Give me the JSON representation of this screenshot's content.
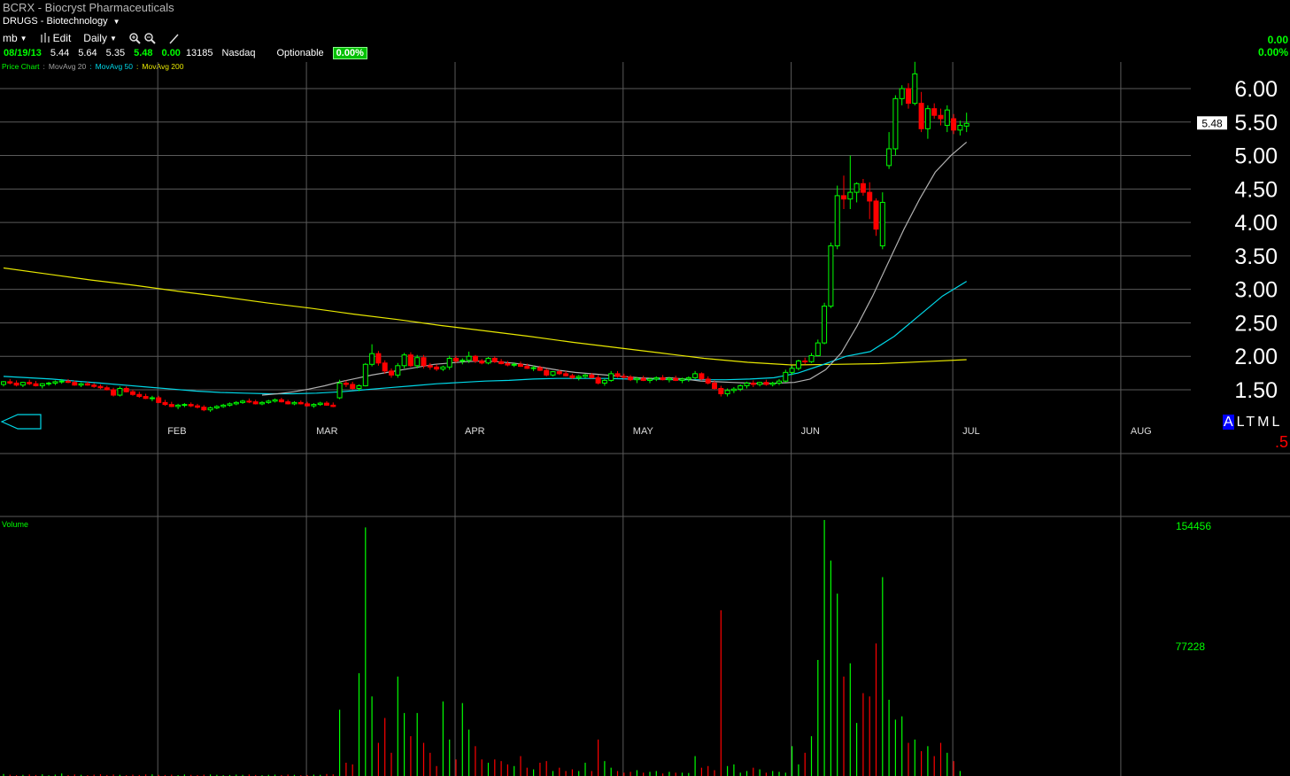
{
  "header": {
    "title": "BCRX - Biocryst Pharmaceuticals",
    "sector": "DRUGS - Biotechnology",
    "user_menu": "mb",
    "edit_label": "Edit",
    "period_label": "Daily"
  },
  "quote": {
    "date": "08/19/13",
    "open": "5.44",
    "high": "5.64",
    "low": "5.35",
    "close": "5.48",
    "change": "0.00",
    "volume": "13185",
    "exchange": "Nasdaq",
    "optionable_label": "Optionable",
    "pct_change": "0.00%"
  },
  "right_panel": {
    "change": "0.00",
    "pct_change": "0.00%"
  },
  "legend": {
    "price_chart": "Price Chart",
    "ma20": "MovAvg 20",
    "ma50": "MovAvg 50",
    "ma200": "MovAvg 200"
  },
  "colors": {
    "up": "#00ff00",
    "down": "#ff0000",
    "ma20": "#b0b0b0",
    "ma50": "#00d8e8",
    "ma200": "#e8e800",
    "grid": "#5a5a5a",
    "volume_label": "#00ff00"
  },
  "mode_buttons": [
    "A",
    "L",
    "T",
    "M",
    "L"
  ],
  "corner_value": ".5",
  "chart_data": {
    "type": "candlestick",
    "title": "BCRX - Biocryst Pharmaceuticals",
    "period": "Daily",
    "months": [
      "FEB",
      "MAR",
      "APR",
      "MAY",
      "JUN",
      "JUL",
      "AUG"
    ],
    "month_first_index": [
      24,
      47,
      70,
      96,
      122,
      147,
      173
    ],
    "ylim": [
      1.0,
      6.6
    ],
    "yticks": [
      6.0,
      5.5,
      5.0,
      4.5,
      4.0,
      3.5,
      3.0,
      2.5,
      2.0,
      1.5
    ],
    "last_price_label": "5.48",
    "candles": [
      [
        1.58,
        1.63,
        1.55,
        1.62
      ],
      [
        1.62,
        1.66,
        1.58,
        1.6
      ],
      [
        1.6,
        1.64,
        1.55,
        1.57
      ],
      [
        1.57,
        1.62,
        1.54,
        1.61
      ],
      [
        1.61,
        1.65,
        1.57,
        1.59
      ],
      [
        1.59,
        1.63,
        1.55,
        1.56
      ],
      [
        1.56,
        1.6,
        1.52,
        1.59
      ],
      [
        1.59,
        1.62,
        1.56,
        1.6
      ],
      [
        1.6,
        1.64,
        1.57,
        1.62
      ],
      [
        1.62,
        1.66,
        1.59,
        1.63
      ],
      [
        1.63,
        1.66,
        1.6,
        1.61
      ],
      [
        1.61,
        1.64,
        1.56,
        1.57
      ],
      [
        1.57,
        1.61,
        1.54,
        1.59
      ],
      [
        1.59,
        1.62,
        1.56,
        1.57
      ],
      [
        1.57,
        1.6,
        1.53,
        1.55
      ],
      [
        1.55,
        1.58,
        1.51,
        1.53
      ],
      [
        1.53,
        1.56,
        1.49,
        1.5
      ],
      [
        1.5,
        1.53,
        1.4,
        1.42
      ],
      [
        1.42,
        1.55,
        1.4,
        1.52
      ],
      [
        1.52,
        1.55,
        1.46,
        1.47
      ],
      [
        1.47,
        1.5,
        1.41,
        1.43
      ],
      [
        1.43,
        1.47,
        1.38,
        1.4
      ],
      [
        1.4,
        1.44,
        1.36,
        1.37
      ],
      [
        1.37,
        1.41,
        1.33,
        1.38
      ],
      [
        1.38,
        1.41,
        1.3,
        1.31
      ],
      [
        1.31,
        1.35,
        1.26,
        1.28
      ],
      [
        1.28,
        1.32,
        1.24,
        1.25
      ],
      [
        1.25,
        1.29,
        1.21,
        1.27
      ],
      [
        1.27,
        1.3,
        1.24,
        1.28
      ],
      [
        1.28,
        1.31,
        1.24,
        1.26
      ],
      [
        1.26,
        1.29,
        1.22,
        1.24
      ],
      [
        1.24,
        1.27,
        1.18,
        1.2
      ],
      [
        1.2,
        1.25,
        1.17,
        1.23
      ],
      [
        1.23,
        1.27,
        1.21,
        1.25
      ],
      [
        1.25,
        1.29,
        1.23,
        1.27
      ],
      [
        1.27,
        1.31,
        1.25,
        1.29
      ],
      [
        1.29,
        1.33,
        1.27,
        1.31
      ],
      [
        1.31,
        1.35,
        1.29,
        1.33
      ],
      [
        1.33,
        1.37,
        1.3,
        1.32
      ],
      [
        1.32,
        1.35,
        1.28,
        1.29
      ],
      [
        1.29,
        1.33,
        1.27,
        1.31
      ],
      [
        1.31,
        1.35,
        1.29,
        1.33
      ],
      [
        1.33,
        1.37,
        1.31,
        1.35
      ],
      [
        1.35,
        1.38,
        1.31,
        1.32
      ],
      [
        1.32,
        1.35,
        1.28,
        1.29
      ],
      [
        1.29,
        1.33,
        1.27,
        1.31
      ],
      [
        1.31,
        1.34,
        1.28,
        1.29
      ],
      [
        1.29,
        1.32,
        1.25,
        1.26
      ],
      [
        1.26,
        1.3,
        1.23,
        1.28
      ],
      [
        1.28,
        1.32,
        1.26,
        1.3
      ],
      [
        1.3,
        1.33,
        1.26,
        1.27
      ],
      [
        1.27,
        1.31,
        1.24,
        1.25
      ],
      [
        1.38,
        1.65,
        1.36,
        1.6
      ],
      [
        1.6,
        1.64,
        1.54,
        1.58
      ],
      [
        1.58,
        1.62,
        1.5,
        1.52
      ],
      [
        1.52,
        1.58,
        1.48,
        1.56
      ],
      [
        1.56,
        1.9,
        1.55,
        1.88
      ],
      [
        1.88,
        2.18,
        1.85,
        2.04
      ],
      [
        2.04,
        2.08,
        1.86,
        1.9
      ],
      [
        1.9,
        1.94,
        1.74,
        1.78
      ],
      [
        1.78,
        1.82,
        1.68,
        1.72
      ],
      [
        1.72,
        1.9,
        1.68,
        1.86
      ],
      [
        1.86,
        2.05,
        1.82,
        2.02
      ],
      [
        2.02,
        2.06,
        1.84,
        1.86
      ],
      [
        1.86,
        2.02,
        1.82,
        1.98
      ],
      [
        1.98,
        2.02,
        1.82,
        1.86
      ],
      [
        1.86,
        1.9,
        1.8,
        1.84
      ],
      [
        1.84,
        1.88,
        1.78,
        1.81
      ],
      [
        1.81,
        1.86,
        1.78,
        1.84
      ],
      [
        1.84,
        2.01,
        1.8,
        1.97
      ],
      [
        1.97,
        2.01,
        1.9,
        1.93
      ],
      [
        1.93,
        1.97,
        1.88,
        1.94
      ],
      [
        1.94,
        2.07,
        1.9,
        2.0
      ],
      [
        2.0,
        2.02,
        1.9,
        1.93
      ],
      [
        1.93,
        1.96,
        1.88,
        1.9
      ],
      [
        1.9,
        1.99,
        1.88,
        1.97
      ],
      [
        1.97,
        2.0,
        1.9,
        1.92
      ],
      [
        1.92,
        1.96,
        1.88,
        1.89
      ],
      [
        1.89,
        1.93,
        1.85,
        1.87
      ],
      [
        1.87,
        1.91,
        1.84,
        1.88
      ],
      [
        1.88,
        1.92,
        1.84,
        1.85
      ],
      [
        1.85,
        1.89,
        1.81,
        1.82
      ],
      [
        1.82,
        1.86,
        1.78,
        1.83
      ],
      [
        1.83,
        1.86,
        1.78,
        1.79
      ],
      [
        1.79,
        1.82,
        1.7,
        1.72
      ],
      [
        1.72,
        1.78,
        1.7,
        1.77
      ],
      [
        1.77,
        1.8,
        1.72,
        1.74
      ],
      [
        1.74,
        1.78,
        1.7,
        1.71
      ],
      [
        1.71,
        1.74,
        1.66,
        1.68
      ],
      [
        1.68,
        1.72,
        1.64,
        1.7
      ],
      [
        1.7,
        1.74,
        1.67,
        1.72
      ],
      [
        1.72,
        1.75,
        1.67,
        1.68
      ],
      [
        1.68,
        1.72,
        1.58,
        1.6
      ],
      [
        1.6,
        1.66,
        1.56,
        1.64
      ],
      [
        1.64,
        1.78,
        1.62,
        1.74
      ],
      [
        1.74,
        1.78,
        1.68,
        1.7
      ],
      [
        1.7,
        1.74,
        1.66,
        1.69
      ],
      [
        1.69,
        1.72,
        1.63,
        1.65
      ],
      [
        1.65,
        1.69,
        1.6,
        1.67
      ],
      [
        1.67,
        1.71,
        1.63,
        1.64
      ],
      [
        1.64,
        1.68,
        1.6,
        1.66
      ],
      [
        1.66,
        1.7,
        1.63,
        1.68
      ],
      [
        1.68,
        1.72,
        1.64,
        1.65
      ],
      [
        1.65,
        1.69,
        1.61,
        1.67
      ],
      [
        1.67,
        1.71,
        1.63,
        1.64
      ],
      [
        1.64,
        1.68,
        1.6,
        1.66
      ],
      [
        1.66,
        1.7,
        1.62,
        1.68
      ],
      [
        1.68,
        1.78,
        1.66,
        1.74
      ],
      [
        1.74,
        1.76,
        1.64,
        1.66
      ],
      [
        1.66,
        1.7,
        1.58,
        1.6
      ],
      [
        1.6,
        1.64,
        1.5,
        1.52
      ],
      [
        1.52,
        1.56,
        1.4,
        1.44
      ],
      [
        1.44,
        1.52,
        1.4,
        1.49
      ],
      [
        1.49,
        1.54,
        1.45,
        1.51
      ],
      [
        1.51,
        1.58,
        1.48,
        1.56
      ],
      [
        1.56,
        1.62,
        1.52,
        1.6
      ],
      [
        1.6,
        1.64,
        1.54,
        1.58
      ],
      [
        1.58,
        1.62,
        1.55,
        1.61
      ],
      [
        1.61,
        1.65,
        1.56,
        1.58
      ],
      [
        1.58,
        1.62,
        1.55,
        1.6
      ],
      [
        1.6,
        1.66,
        1.57,
        1.63
      ],
      [
        1.63,
        1.8,
        1.61,
        1.76
      ],
      [
        1.76,
        1.86,
        1.72,
        1.82
      ],
      [
        1.82,
        1.95,
        1.79,
        1.93
      ],
      [
        1.93,
        1.98,
        1.88,
        1.92
      ],
      [
        1.92,
        2.05,
        1.9,
        2.01
      ],
      [
        2.01,
        2.25,
        2.0,
        2.2
      ],
      [
        2.2,
        2.8,
        2.18,
        2.75
      ],
      [
        2.75,
        3.7,
        2.72,
        3.65
      ],
      [
        3.65,
        4.55,
        3.6,
        4.4
      ],
      [
        4.4,
        4.7,
        4.2,
        4.35
      ],
      [
        4.35,
        5.0,
        4.2,
        4.45
      ],
      [
        4.45,
        4.6,
        4.3,
        4.58
      ],
      [
        4.58,
        4.65,
        4.4,
        4.45
      ],
      [
        4.45,
        4.6,
        4.05,
        4.32
      ],
      [
        4.32,
        4.36,
        3.8,
        3.9
      ],
      [
        3.65,
        4.45,
        3.6,
        4.3
      ],
      [
        4.85,
        5.35,
        4.8,
        5.1
      ],
      [
        5.1,
        5.9,
        5.0,
        5.85
      ],
      [
        5.85,
        6.05,
        5.75,
        6.0
      ],
      [
        6.0,
        6.08,
        5.7,
        5.78
      ],
      [
        5.78,
        6.4,
        5.75,
        6.22
      ],
      [
        5.78,
        5.95,
        5.35,
        5.4
      ],
      [
        5.4,
        5.75,
        5.25,
        5.7
      ],
      [
        5.7,
        5.78,
        5.55,
        5.6
      ],
      [
        5.6,
        5.7,
        5.45,
        5.55
      ],
      [
        5.45,
        5.75,
        5.35,
        5.68
      ],
      [
        5.55,
        5.62,
        5.32,
        5.38
      ],
      [
        5.38,
        5.52,
        5.3,
        5.45
      ],
      [
        5.44,
        5.64,
        5.35,
        5.48
      ]
    ],
    "ma20_start_index": 40,
    "ma20": [
      1.42,
      1.44,
      1.47,
      1.51,
      1.56,
      1.62,
      1.67,
      1.72,
      1.76,
      1.8,
      1.84,
      1.88,
      1.9,
      1.92,
      1.93,
      1.92,
      1.9,
      1.87,
      1.83,
      1.79,
      1.76,
      1.74,
      1.72,
      1.7,
      1.68,
      1.67,
      1.68,
      1.66,
      1.63,
      1.62,
      1.61,
      1.6,
      1.59,
      1.6,
      1.61,
      1.66,
      1.8,
      2.05,
      2.45,
      2.9,
      3.4,
      3.9,
      4.35,
      4.75,
      5.0,
      5.2
    ],
    "ma50": [
      1.7,
      1.68,
      1.66,
      1.63,
      1.6,
      1.57,
      1.54,
      1.51,
      1.48,
      1.46,
      1.45,
      1.44,
      1.44,
      1.45,
      1.47,
      1.5,
      1.53,
      1.56,
      1.59,
      1.61,
      1.63,
      1.64,
      1.66,
      1.67,
      1.67,
      1.67,
      1.66,
      1.66,
      1.65,
      1.65,
      1.65,
      1.66,
      1.68,
      1.75,
      1.87,
      2.0,
      2.07,
      2.3,
      2.6,
      2.9,
      3.12
    ],
    "ma200": [
      3.32,
      3.23,
      3.14,
      3.06,
      2.97,
      2.89,
      2.8,
      2.72,
      2.63,
      2.55,
      2.46,
      2.38,
      2.3,
      2.21,
      2.13,
      2.05,
      1.97,
      1.91,
      1.87,
      1.88,
      1.89,
      1.92,
      1.95
    ],
    "volume": {
      "ylabel": "Volume",
      "ticks": [
        "154456",
        "77228"
      ],
      "ymax": 154456,
      "values": [
        1200,
        800,
        500,
        700,
        900,
        600,
        1000,
        400,
        800,
        1500,
        600,
        900,
        700,
        500,
        800,
        1100,
        600,
        900,
        700,
        500,
        800,
        600,
        900,
        1000,
        700,
        600,
        800,
        500,
        900,
        700,
        600,
        800,
        900,
        700,
        500,
        600,
        800,
        700,
        900,
        600,
        500,
        700,
        800,
        600,
        900,
        700,
        500,
        600,
        800,
        700,
        1200,
        1000,
        40000,
        8000,
        7000,
        62000,
        150000,
        48000,
        20000,
        35000,
        14000,
        60000,
        38000,
        24000,
        38000,
        20000,
        14000,
        6000,
        45000,
        22000,
        10000,
        44000,
        28000,
        18000,
        10000,
        8000,
        10000,
        9000,
        7000,
        6000,
        12000,
        5000,
        4000,
        8000,
        9000,
        3000,
        5000,
        3000,
        4000,
        3000,
        8000,
        3000,
        22000,
        9000,
        5000,
        3000,
        2000,
        2500,
        3500,
        2000,
        2500,
        3000,
        1500,
        2500,
        2000,
        2000,
        1800,
        12000,
        5000,
        6000,
        3500,
        100000,
        6000,
        7000,
        2000,
        3000,
        5000,
        4000,
        2000,
        3000,
        2500,
        2000,
        18000,
        7000,
        14000,
        24000,
        70000,
        154456,
        130000,
        110000,
        60000,
        68000,
        32000,
        50000,
        48000,
        80000,
        120000,
        46000,
        34000,
        36000,
        20000,
        22000,
        15000,
        18000,
        12000,
        20000,
        14000,
        9000,
        3000
      ]
    }
  }
}
